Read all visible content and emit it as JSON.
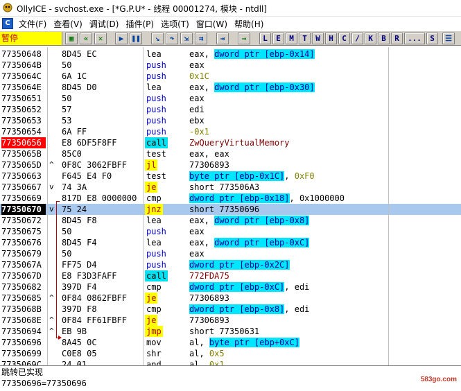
{
  "window": {
    "title": "OllyICE - svchost.exe - [*G.P.U* - 线程 00001274, 模块 - ntdll]"
  },
  "menu": [
    {
      "label": "文件(F)"
    },
    {
      "label": "查看(V)"
    },
    {
      "label": "调试(D)"
    },
    {
      "label": "插件(P)"
    },
    {
      "label": "选项(T)"
    },
    {
      "label": "窗口(W)"
    },
    {
      "label": "帮助(H)"
    }
  ],
  "toolbar": {
    "status": "暂停",
    "icon_buttons": [
      {
        "name": "open-icon"
      },
      {
        "name": "rewind-icon"
      },
      {
        "name": "close-process-icon"
      },
      {
        "name": "run-icon"
      },
      {
        "name": "pause-icon"
      },
      {
        "name": "step-into-icon"
      },
      {
        "name": "step-over-icon"
      },
      {
        "name": "trace-into-icon"
      },
      {
        "name": "trace-over-icon"
      },
      {
        "name": "execute-till-return-icon"
      },
      {
        "name": "goto-icon"
      }
    ],
    "letters": [
      "L",
      "E",
      "M",
      "T",
      "W",
      "H",
      "C",
      "/",
      "K",
      "B",
      "R",
      "...",
      "S"
    ]
  },
  "disassembly": {
    "rows": [
      {
        "addr": "77350648",
        "mark": "",
        "hex": "8D45 EC",
        "mnem": "lea",
        "ops": [
          {
            "t": "eax, ",
            "k": "op"
          },
          {
            "t": "dword ptr [ebp-0x14]",
            "k": "mem"
          }
        ]
      },
      {
        "addr": "7735064B",
        "mark": "",
        "hex": "50",
        "mnem": "push",
        "mstyle": "blue",
        "ops": [
          {
            "t": "eax",
            "k": "op"
          }
        ]
      },
      {
        "addr": "7735064C",
        "mark": "",
        "hex": "6A 1C",
        "mnem": "push",
        "mstyle": "blue",
        "ops": [
          {
            "t": "0x1C",
            "k": "num"
          }
        ]
      },
      {
        "addr": "7735064E",
        "mark": "",
        "hex": "8D45 D0",
        "mnem": "lea",
        "ops": [
          {
            "t": "eax, ",
            "k": "op"
          },
          {
            "t": "dword ptr [ebp-0x30]",
            "k": "mem"
          }
        ]
      },
      {
        "addr": "77350651",
        "mark": "",
        "hex": "50",
        "mnem": "push",
        "mstyle": "blue",
        "ops": [
          {
            "t": "eax",
            "k": "op"
          }
        ]
      },
      {
        "addr": "77350652",
        "mark": "",
        "hex": "57",
        "mnem": "push",
        "mstyle": "blue",
        "ops": [
          {
            "t": "edi",
            "k": "op"
          }
        ]
      },
      {
        "addr": "77350653",
        "mark": "",
        "hex": "53",
        "mnem": "push",
        "mstyle": "blue",
        "ops": [
          {
            "t": "ebx",
            "k": "op"
          }
        ]
      },
      {
        "addr": "77350654",
        "mark": "",
        "hex": "6A FF",
        "mnem": "push",
        "mstyle": "blue",
        "ops": [
          {
            "t": "-0x1",
            "k": "num"
          }
        ]
      },
      {
        "addr": "77350656",
        "astyle": "bp",
        "mark": "",
        "hex": "E8 6DF5F8FF",
        "mnem": "call",
        "mstyle": "hl-cyan",
        "ops": [
          {
            "t": "ZwQueryVirtualMemory",
            "k": "api"
          }
        ]
      },
      {
        "addr": "7735065B",
        "mark": "",
        "hex": "85C0",
        "mnem": "test",
        "ops": [
          {
            "t": "eax, eax",
            "k": "op"
          }
        ]
      },
      {
        "addr": "7735065D",
        "mark": "^",
        "hex": "0F8C 3062FBFF",
        "mnem": "jl",
        "mstyle": "hl-yellow",
        "ops": [
          {
            "t": "77306893",
            "k": "op"
          }
        ]
      },
      {
        "addr": "77350663",
        "mark": "",
        "hex": "F645 E4 F0",
        "mnem": "test",
        "ops": [
          {
            "t": "byte ptr [ebp-0x1C]",
            "k": "mem"
          },
          {
            "t": ", ",
            "k": "op"
          },
          {
            "t": "0xF0",
            "k": "num"
          }
        ]
      },
      {
        "addr": "77350667",
        "mark": "v",
        "hex": "74 3A",
        "mnem": "je",
        "mstyle": "hl-yellow",
        "ops": [
          {
            "t": "short 773506A3",
            "k": "op"
          }
        ]
      },
      {
        "addr": "77350669",
        "mark": "",
        "hex": "817D E8 0000000",
        "mnem": "cmp",
        "ops": [
          {
            "t": "dword ptr [ebp-0x18]",
            "k": "mem"
          },
          {
            "t": ", 0x1000000",
            "k": "op"
          }
        ]
      },
      {
        "addr": "77350670",
        "astyle": "cur",
        "selected": true,
        "mark": "v",
        "hex": "75 24",
        "mnem": "jnz",
        "mstyle": "hl-yellow",
        "ops": [
          {
            "t": "short 77350696",
            "k": "op"
          }
        ]
      },
      {
        "addr": "77350672",
        "mark": "",
        "hex": "8D45 F8",
        "mnem": "lea",
        "ops": [
          {
            "t": "eax, ",
            "k": "op"
          },
          {
            "t": "dword ptr [ebp-0x8]",
            "k": "mem"
          }
        ]
      },
      {
        "addr": "77350675",
        "mark": "",
        "hex": "50",
        "mnem": "push",
        "mstyle": "blue",
        "ops": [
          {
            "t": "eax",
            "k": "op"
          }
        ]
      },
      {
        "addr": "77350676",
        "mark": "",
        "hex": "8D45 F4",
        "mnem": "lea",
        "ops": [
          {
            "t": "eax, ",
            "k": "op"
          },
          {
            "t": "dword ptr [ebp-0xC]",
            "k": "mem"
          }
        ]
      },
      {
        "addr": "77350679",
        "mark": "",
        "hex": "50",
        "mnem": "push",
        "mstyle": "blue",
        "ops": [
          {
            "t": "eax",
            "k": "op"
          }
        ]
      },
      {
        "addr": "7735067A",
        "mark": "",
        "hex": "FF75 D4",
        "mnem": "push",
        "mstyle": "blue",
        "ops": [
          {
            "t": "dword ptr [ebp-0x2C]",
            "k": "mem"
          }
        ]
      },
      {
        "addr": "7735067D",
        "mark": "",
        "hex": "E8 F3D3FAFF",
        "mnem": "call",
        "mstyle": "hl-cyan",
        "ops": [
          {
            "t": "772FDA75",
            "k": "api"
          }
        ]
      },
      {
        "addr": "77350682",
        "mark": "",
        "hex": "397D F4",
        "mnem": "cmp",
        "ops": [
          {
            "t": "dword ptr [ebp-0xC]",
            "k": "mem"
          },
          {
            "t": ", edi",
            "k": "op"
          }
        ]
      },
      {
        "addr": "77350685",
        "mark": "^",
        "hex": "0F84 0862FBFF",
        "mnem": "je",
        "mstyle": "hl-yellow",
        "ops": [
          {
            "t": "77306893",
            "k": "op"
          }
        ]
      },
      {
        "addr": "7735068B",
        "mark": "",
        "hex": "397D F8",
        "mnem": "cmp",
        "ops": [
          {
            "t": "dword ptr [ebp-0x8]",
            "k": "mem"
          },
          {
            "t": ", edi",
            "k": "op"
          }
        ]
      },
      {
        "addr": "7735068E",
        "mark": "^",
        "hex": "0F84 FF61FBFF",
        "mnem": "je",
        "mstyle": "hl-yellow",
        "ops": [
          {
            "t": "77306893",
            "k": "op"
          }
        ]
      },
      {
        "addr": "77350694",
        "mark": "^",
        "hex": "EB 9B",
        "mnem": "jmp",
        "mstyle": "hl-yellow",
        "ops": [
          {
            "t": "short 77350631",
            "k": "op"
          }
        ]
      },
      {
        "addr": "77350696",
        "mark": "",
        "hex": "8A45 0C",
        "mnem": "mov",
        "ops": [
          {
            "t": "al, ",
            "k": "op"
          },
          {
            "t": "byte ptr [ebp+0xC]",
            "k": "mem"
          }
        ]
      },
      {
        "addr": "77350699",
        "mark": "",
        "hex": "C0E8 05",
        "mnem": "shr",
        "ops": [
          {
            "t": "al, ",
            "k": "op"
          },
          {
            "t": "0x5",
            "k": "num"
          }
        ]
      },
      {
        "addr": "7735069C",
        "mark": "",
        "hex": "24 01",
        "mnem": "and",
        "ops": [
          {
            "t": "al, ",
            "k": "op"
          },
          {
            "t": "0x1",
            "k": "num"
          }
        ]
      }
    ]
  },
  "info": {
    "line1": "跳转已实现",
    "line2": "77350696=77350696",
    "watermark": "583go.com"
  },
  "colors": {
    "breakpoint": "#ff0000",
    "selection": "#a8c8ee",
    "call_highlight": "#00e0f0",
    "jump_highlight": "#ffff00",
    "memory_operand": "#00e6ff",
    "status_bg": "#ffff00"
  }
}
